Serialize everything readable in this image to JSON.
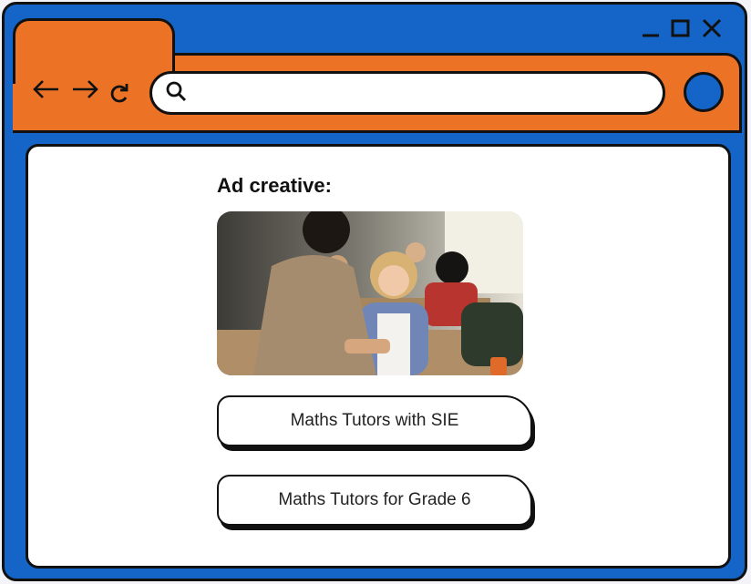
{
  "window": {
    "controls": [
      "minimize-icon",
      "maximize-icon",
      "close-icon"
    ]
  },
  "toolbar": {
    "icons": [
      "back-arrow-icon",
      "forward-arrow-icon",
      "reload-icon",
      "search-icon"
    ],
    "address_value": "",
    "address_placeholder": ""
  },
  "colors": {
    "frame_blue": "#1565c8",
    "toolbar_orange": "#ec7326",
    "outline": "#111111"
  },
  "main": {
    "heading": "Ad creative:",
    "image": "classroom-photo",
    "buttons": [
      {
        "label": "Maths Tutors with SIE"
      },
      {
        "label": "Maths Tutors for Grade 6"
      }
    ]
  }
}
